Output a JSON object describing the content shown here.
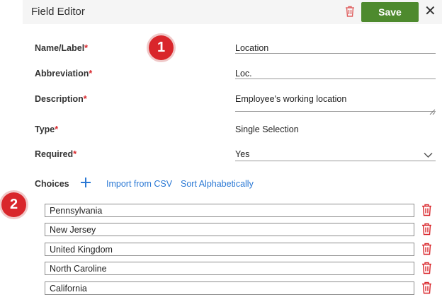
{
  "header": {
    "title": "Field Editor",
    "save_label": "Save",
    "close_glyph": "✕"
  },
  "badges": [
    "1",
    "2"
  ],
  "form": {
    "name_label": "Name/Label",
    "name_value": "Location",
    "abbr_label": "Abbreviation",
    "abbr_value": "Loc.",
    "desc_label": "Description",
    "desc_value": "Employee's working location",
    "type_label": "Type",
    "type_value": "Single Selection",
    "required_label": "Required",
    "required_value": "Yes",
    "required_marker": "*"
  },
  "choices": {
    "label": "Choices",
    "import_label": "Import from CSV",
    "sort_label": "Sort Alphabetically",
    "items": [
      "Pennsylvania",
      "New Jersey",
      "United Kingdom",
      "North Caroline",
      "California"
    ]
  },
  "icons": {
    "delete": "trash-icon",
    "add": "plus-icon",
    "dropdown": "chevron-down-icon",
    "close": "close-icon",
    "resize": "resize-grip-icon"
  },
  "colors": {
    "accent_green": "#4e8a2e",
    "danger_red": "#d9262b",
    "link_blue": "#2a78d4",
    "header_bg": "#f5f5f5"
  }
}
